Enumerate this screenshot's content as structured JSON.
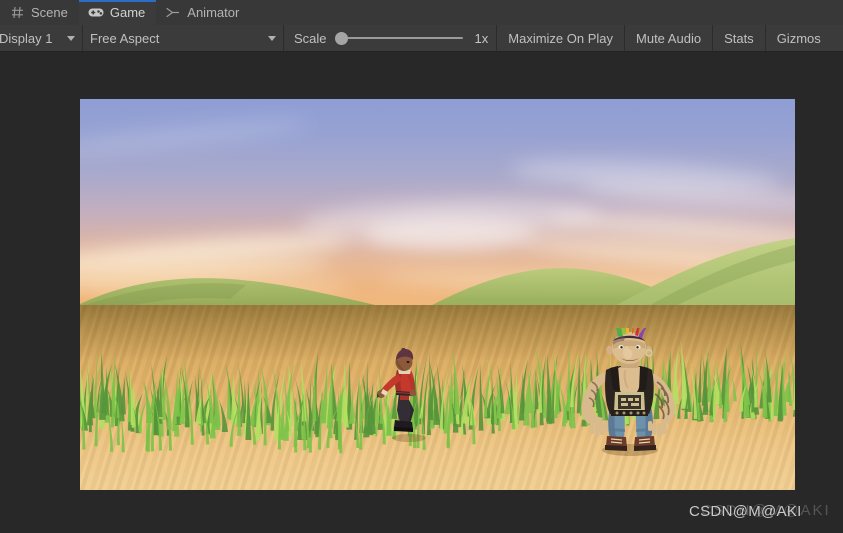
{
  "window": {
    "background_color": "#282828",
    "chrome_color": "#3b3b3b",
    "accent_color": "#2b6ec9"
  },
  "tabs": [
    {
      "label": "Scene",
      "icon": "grid-icon",
      "active": false
    },
    {
      "label": "Game",
      "icon": "gamepad-icon",
      "active": true
    },
    {
      "label": "Animator",
      "icon": "animator-icon",
      "active": false
    }
  ],
  "toolbar": {
    "display_dropdown": {
      "label": "Display 1",
      "icon": "chevron-down-icon"
    },
    "aspect_dropdown": {
      "label": "Free Aspect",
      "icon": "chevron-down-icon"
    },
    "scale": {
      "label": "Scale",
      "value": "1x",
      "slider_position_percent": 0
    },
    "maximize_on_play": "Maximize On Play",
    "mute_audio": "Mute Audio",
    "stats": "Stats",
    "gizmos": "Gizmos"
  },
  "game_view": {
    "scene_description": "Third-person game scene at sunset with two characters in a grassy field",
    "sky": {
      "top_color": "#8e9dd4",
      "mid_color": "#efb57c",
      "bottom_color": "#d96f31"
    },
    "terrain": {
      "hill_color": "#93b05a",
      "hill_shadow_color": "#6f8c45",
      "grass_color": "#7ec34a",
      "grass_highlight_color": "#a8dc5d",
      "flower_color": "#f2e03c",
      "ground_color": "#e2b268"
    },
    "characters": [
      {
        "name": "player-character",
        "description": "Human warrior in red tunic crouch-running",
        "shirt_color": "#c0392b",
        "skin_color": "#8a5a3c",
        "hair_color": "#6b3a4a",
        "pants_color": "#2e2a30"
      },
      {
        "name": "ogre-enemy",
        "description": "Large punk ogre with rainbow mohawk and tattoos",
        "skin_color": "#d8b98a",
        "mohawk_colors": [
          "#4caf50",
          "#ffc107",
          "#e53935",
          "#7e57c2"
        ],
        "vest_color": "#2b2420",
        "jeans_color": "#5e83a0"
      }
    ]
  },
  "watermark": {
    "text": "CSDN@M@AKI",
    "ghost_text": "CSDN@M@AKI"
  }
}
